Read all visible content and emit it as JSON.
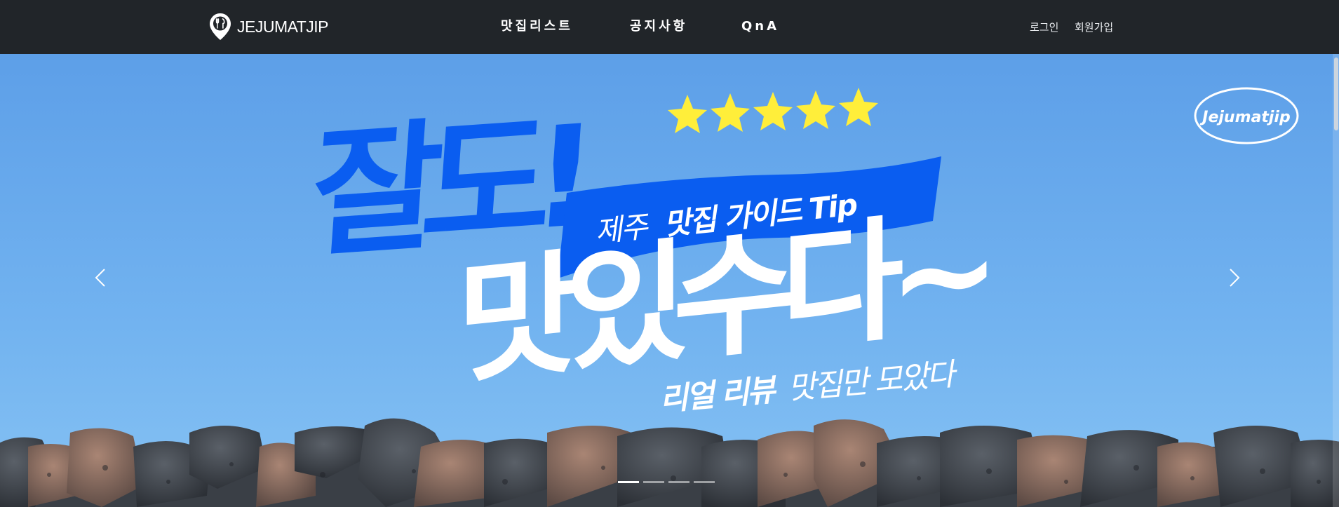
{
  "navbar": {
    "brand": "JEJUMATJIP",
    "links": [
      {
        "label": "맛집리스트"
      },
      {
        "label": "공지사항"
      },
      {
        "label": "QnA"
      }
    ],
    "auth": {
      "login": "로그인",
      "signup": "회원가입"
    }
  },
  "hero": {
    "headline_top": "잘도!",
    "ribbon_light": "제주",
    "ribbon_bold": "맛집 가이드 Tip",
    "headline_main": "맛있수다~",
    "tagline_bold": "리얼 리뷰",
    "tagline_light": "맛집만 모았다",
    "badge": "Jejumatjip",
    "stars": 5
  },
  "carousel": {
    "slide_count": 4,
    "active_index": 0,
    "sky_color": "#6aaeeb",
    "accent_blue": "#0a5df0",
    "star_color": "#ffee3a"
  }
}
